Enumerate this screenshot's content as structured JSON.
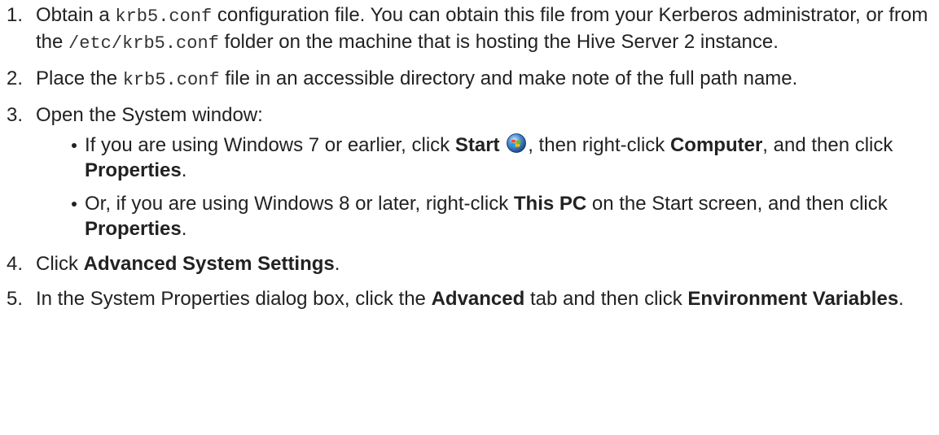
{
  "steps": [
    {
      "number": "1.",
      "text_1": "Obtain a ",
      "code_1": "krb5.conf",
      "text_2": " configuration file. You can obtain this file from your Kerberos administrator, or from the ",
      "code_2": "/etc/krb5.conf",
      "text_3": " folder on the machine that is hosting the Hive Server 2 instance."
    },
    {
      "number": "2.",
      "text_1": "Place the ",
      "code_1": "krb5.conf",
      "text_2": " file in an accessible directory and make note of the full path name."
    },
    {
      "number": "3.",
      "text_1": "Open the System window:",
      "bullets": [
        {
          "t1": "If you are using Windows 7 or earlier, click ",
          "b1": "Start",
          "icon": "windows-start-orb-icon",
          "t2": ", then right-click ",
          "b2": "Computer",
          "t3": ", and then click ",
          "b3": "Properties",
          "t4": "."
        },
        {
          "t1": "Or, if you are using Windows 8 or later, right-click ",
          "b1": "This PC",
          "t2": " on the Start screen, and then click ",
          "b2": "Properties",
          "t3": "."
        }
      ]
    },
    {
      "number": "4.",
      "text_1": "Click ",
      "bold_1": "Advanced System Settings",
      "text_2": "."
    },
    {
      "number": "5.",
      "text_1": "In the System Properties dialog box, click the ",
      "bold_1": "Advanced",
      "text_2": " tab and then click ",
      "bold_2": "Environment Variables",
      "text_3": "."
    }
  ],
  "colors": {
    "text": "#222222",
    "code": "#333333",
    "background": "#ffffff"
  }
}
